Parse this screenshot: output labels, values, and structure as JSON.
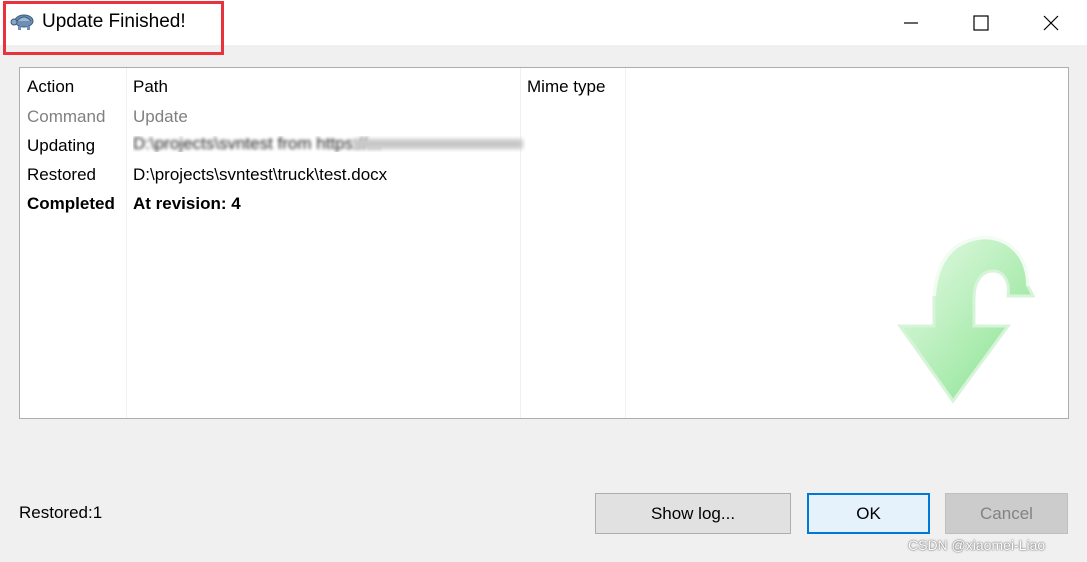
{
  "window": {
    "title": "Update Finished!",
    "icon": "tortoisesvn-turtle-icon",
    "highlight_color": "#e8333c"
  },
  "table": {
    "columns": [
      "Action",
      "Path",
      "Mime type"
    ],
    "rows": [
      {
        "action": "Command",
        "path": "Update",
        "style": "gray"
      },
      {
        "action": "Updating",
        "path": "D:\\projects\\svntest from https://...",
        "style": "blurred"
      },
      {
        "action": "Restored",
        "path": "D:\\projects\\svntest\\truck\\test.docx",
        "style": "normal"
      },
      {
        "action": "Completed",
        "path": "At revision: 4",
        "style": "bold"
      }
    ]
  },
  "status": {
    "text": "Restored:1"
  },
  "buttons": {
    "show_log": "Show log...",
    "ok": "OK",
    "cancel": "Cancel"
  },
  "watermark": "CSDN @xiaomei-Liao",
  "icons": {
    "update-arrow": "green-curved-down-arrow-icon",
    "minimize": "minimize-icon",
    "maximize": "maximize-icon",
    "close": "close-icon"
  },
  "colors": {
    "accent": "#0078d7",
    "arrow_green": "#9de8a4"
  }
}
